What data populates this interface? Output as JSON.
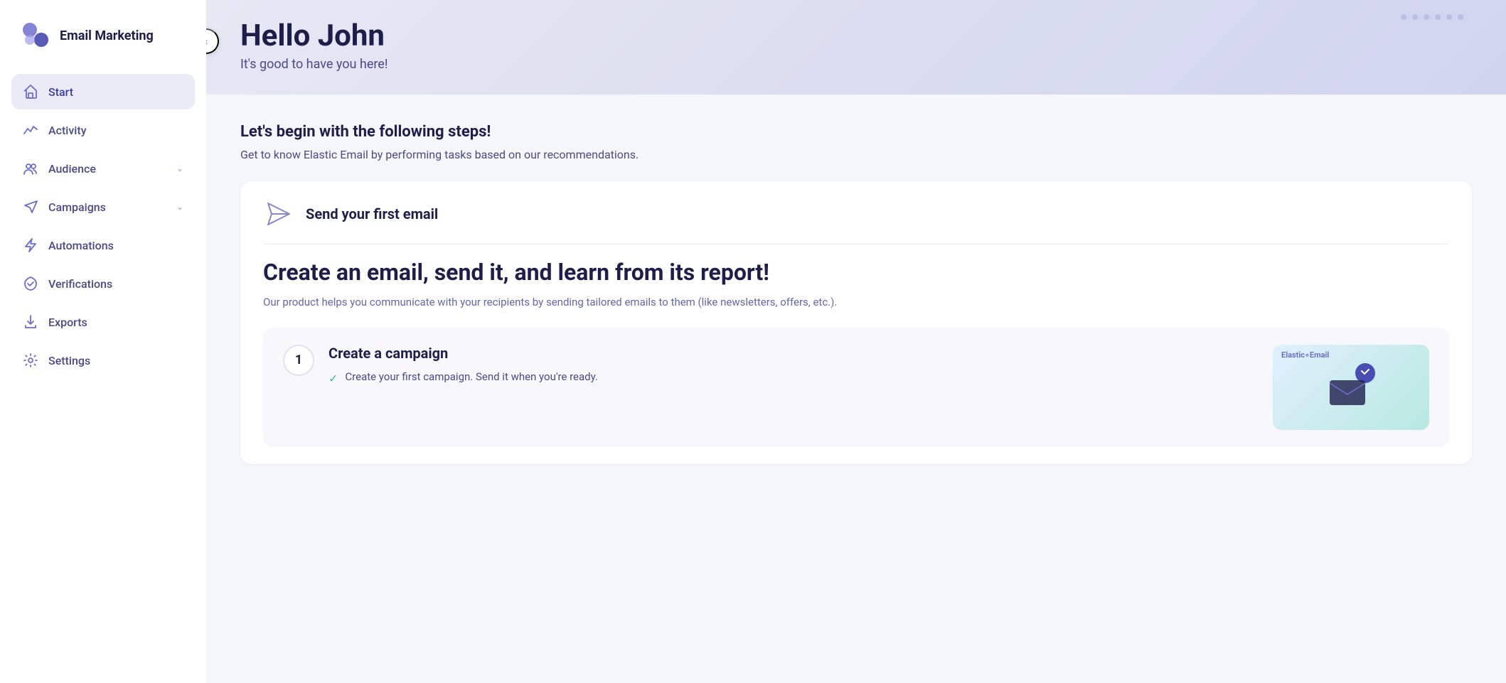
{
  "app": {
    "logo_text": "Email Marketing"
  },
  "sidebar": {
    "items": [
      {
        "id": "start",
        "label": "Start",
        "icon": "home-icon",
        "active": true,
        "has_chevron": false
      },
      {
        "id": "activity",
        "label": "Activity",
        "icon": "activity-icon",
        "active": false,
        "has_chevron": false
      },
      {
        "id": "audience",
        "label": "Audience",
        "icon": "audience-icon",
        "active": false,
        "has_chevron": true
      },
      {
        "id": "campaigns",
        "label": "Campaigns",
        "icon": "campaigns-icon",
        "active": false,
        "has_chevron": true
      },
      {
        "id": "automations",
        "label": "Automations",
        "icon": "automations-icon",
        "active": false,
        "has_chevron": false
      },
      {
        "id": "verifications",
        "label": "Verifications",
        "icon": "verifications-icon",
        "active": false,
        "has_chevron": false
      },
      {
        "id": "exports",
        "label": "Exports",
        "icon": "exports-icon",
        "active": false,
        "has_chevron": false
      },
      {
        "id": "settings",
        "label": "Settings",
        "icon": "settings-icon",
        "active": false,
        "has_chevron": false
      }
    ]
  },
  "header": {
    "title": "Hello John",
    "subtitle": "It's good to have you here!"
  },
  "content": {
    "steps_intro_title": "Let's begin with the following steps!",
    "steps_intro_desc": "Get to know Elastic Email by performing tasks based on our recommendations.",
    "send_first_email_card": {
      "title": "Send your first email"
    },
    "create_email_section": {
      "title": "Create an email, send it, and learn from its report!",
      "desc": "Our product helps you communicate with your recipients by sending tailored emails to them (like newsletters, offers, etc.)."
    },
    "campaign_step": {
      "number": "1",
      "title": "Create a campaign",
      "desc": "Create your first campaign. Send it when you're ready.",
      "brand_label": "Elastic",
      "brand_highlight": "Email"
    }
  }
}
